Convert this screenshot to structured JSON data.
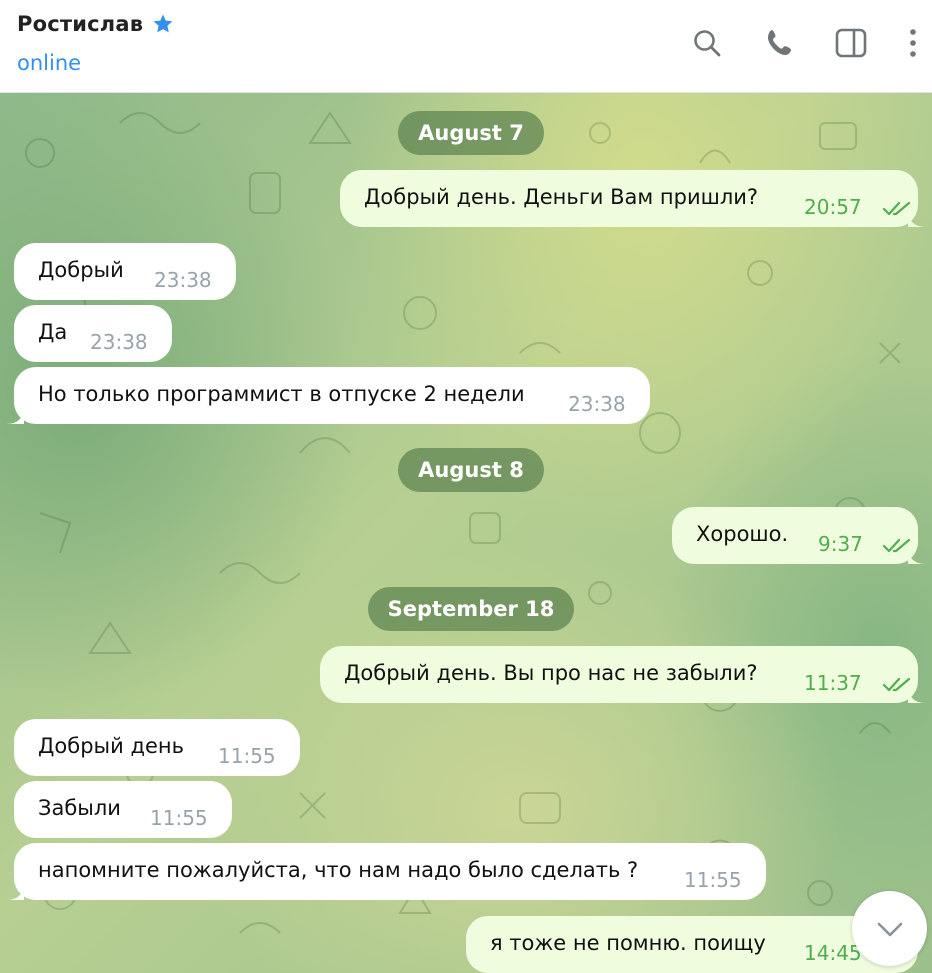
{
  "header": {
    "contact_name": "Ростислав",
    "status": "online",
    "accent_color": "#3390ec",
    "icons": [
      "star-icon",
      "search-icon",
      "phone-icon",
      "sidebar-toggle-icon",
      "more-vertical-icon"
    ]
  },
  "dates": {
    "d1": "August 7",
    "d2": "August 8",
    "d3": "September 18"
  },
  "messages": [
    {
      "dir": "out",
      "text": "Добрый день. Деньги Вам пришли?",
      "time": "20:57",
      "read": true
    },
    {
      "dir": "in",
      "text": "Добрый",
      "time": "23:38"
    },
    {
      "dir": "in",
      "text": "Да",
      "time": "23:38"
    },
    {
      "dir": "in",
      "text": "Но только программист в отпуске 2 недели",
      "time": "23:38"
    },
    {
      "dir": "out",
      "text": "Хорошо.",
      "time": "9:37",
      "read": true
    },
    {
      "dir": "out",
      "text": "Добрый день. Вы про нас не забыли?",
      "time": "11:37",
      "read": true
    },
    {
      "dir": "in",
      "text": "Добрый день",
      "time": "11:55"
    },
    {
      "dir": "in",
      "text": "Забыли",
      "time": "11:55"
    },
    {
      "dir": "in",
      "text": "напомните пожалуйста, что нам надо было сделать ?",
      "time": "11:55"
    },
    {
      "dir": "out",
      "text": "я тоже не помню. поищу",
      "time": "14:45"
    }
  ],
  "colors": {
    "incoming_bubble": "#ffffff",
    "outgoing_bubble": "#effdde",
    "outgoing_time": "#4fae4e",
    "date_pill": "#5c8250"
  }
}
